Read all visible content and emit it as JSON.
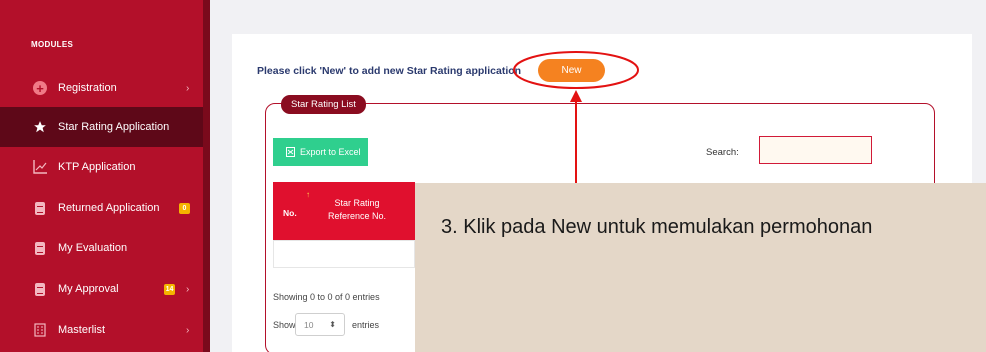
{
  "sidebar": {
    "modules_label": "MODULES",
    "items": [
      {
        "label": "Registration",
        "icon": "plus-circle-icon",
        "chevron": "›"
      },
      {
        "label": "Star Rating Application",
        "icon": "star-icon"
      },
      {
        "label": "KTP Application",
        "icon": "chart-icon"
      },
      {
        "label": "Returned Application",
        "icon": "document-icon",
        "badge": "0"
      },
      {
        "label": "My Evaluation",
        "icon": "document-icon"
      },
      {
        "label": "My Approval",
        "icon": "document-icon",
        "badge": "14",
        "chevron": "›"
      },
      {
        "label": "Masterlist",
        "icon": "building-icon",
        "chevron": "›"
      }
    ]
  },
  "main": {
    "instruction": "Please click 'New' to add new Star Rating application",
    "new_button": "New",
    "legend": "Star Rating List",
    "export_button": "Export to Excel",
    "search_label": "Search:",
    "table": {
      "col_no": "No.",
      "col_ref": "Star Rating Reference No.",
      "sort_indicator": "↑"
    },
    "showing": "Showing 0 to 0 of 0 entries",
    "show_label": "Show",
    "entries_value": "10",
    "entries_label": "entries"
  },
  "annotation": {
    "text": "3. Klik pada New untuk memulakan permohonan"
  },
  "colors": {
    "sidebar": "#b3102a",
    "sidebar_active": "#5e0818",
    "accent_orange": "#f58220",
    "export_green": "#2fcf8e",
    "table_header": "#e0102e",
    "annotation_red": "#e31212",
    "callout_bg": "#e4d7c8"
  }
}
